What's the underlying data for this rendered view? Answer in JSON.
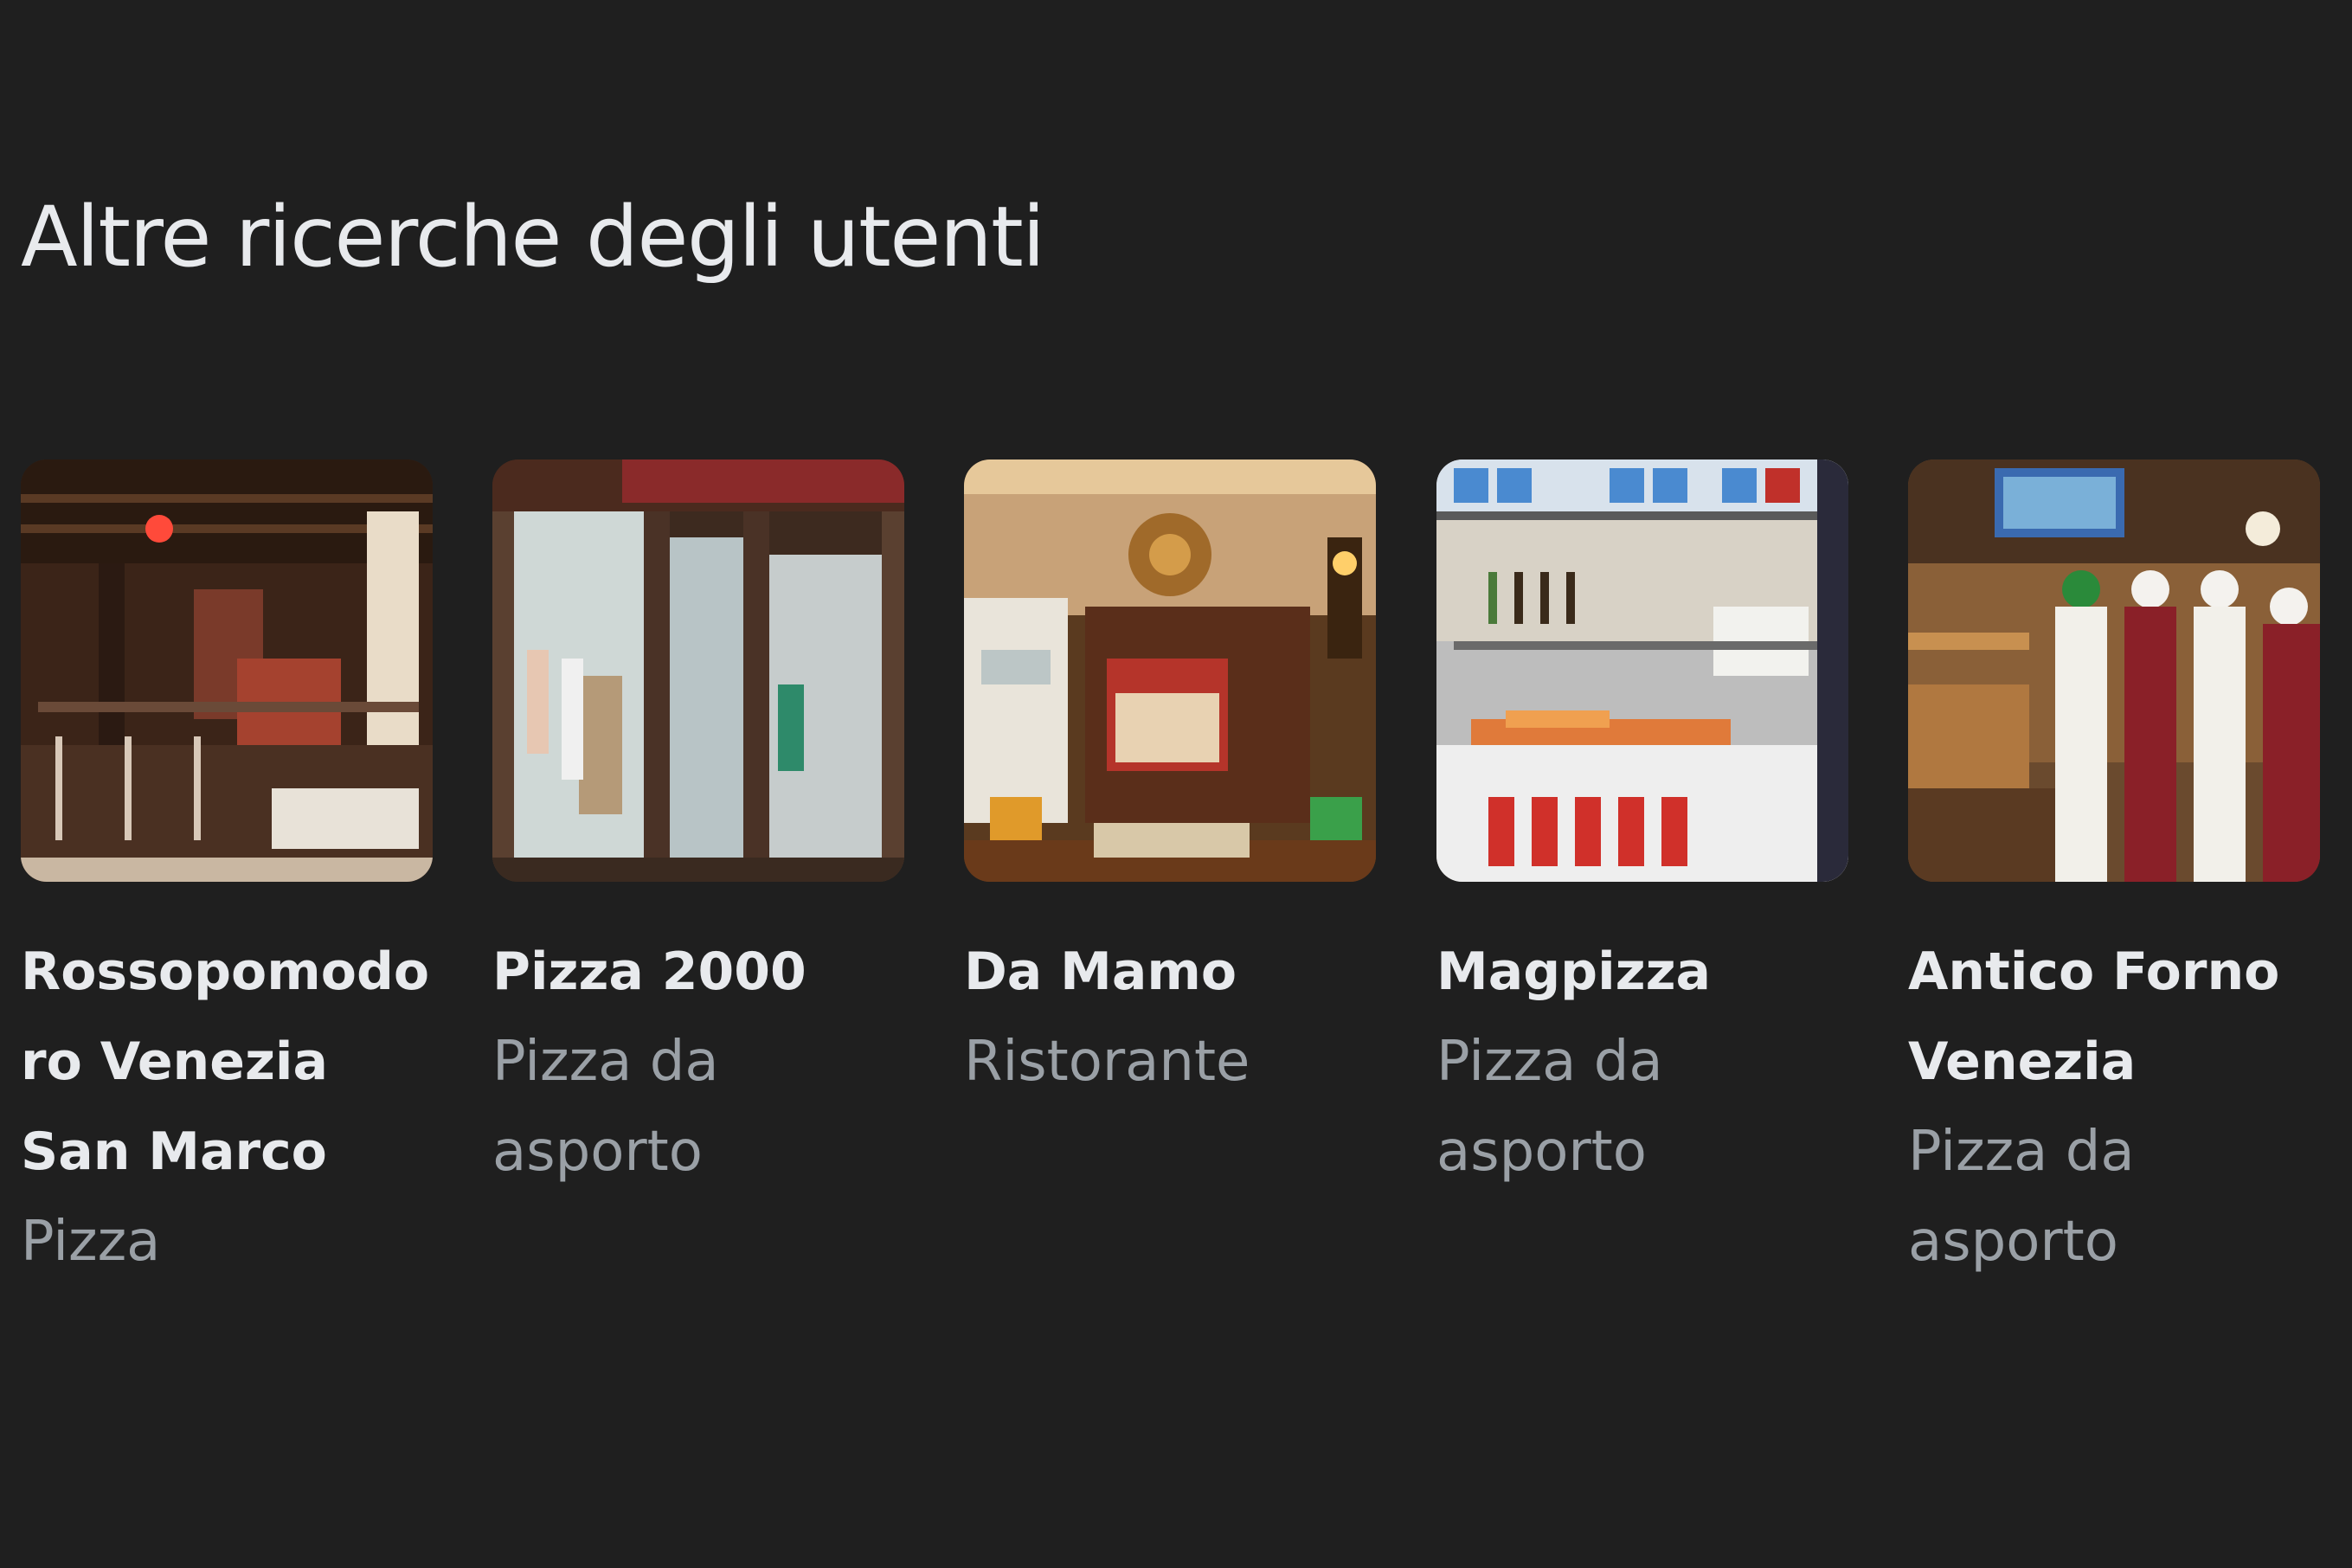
{
  "section": {
    "title": "Altre ricerche degli utenti"
  },
  "cards": [
    {
      "name": "Rossopomodoro Venezia San Marco",
      "type": "Pizza"
    },
    {
      "name": "Pizza 2000",
      "type": "Pizza da asporto"
    },
    {
      "name": "Da Mamo",
      "type": "Ristorante"
    },
    {
      "name": "Magpizza",
      "type": "Pizza da asporto"
    },
    {
      "name": "Antico Forno Venezia",
      "type": "Pizza da asporto"
    }
  ],
  "colors": {
    "background": "#1f1f1f",
    "title_text": "#e8eaed",
    "secondary_text": "#9aa0a6"
  }
}
